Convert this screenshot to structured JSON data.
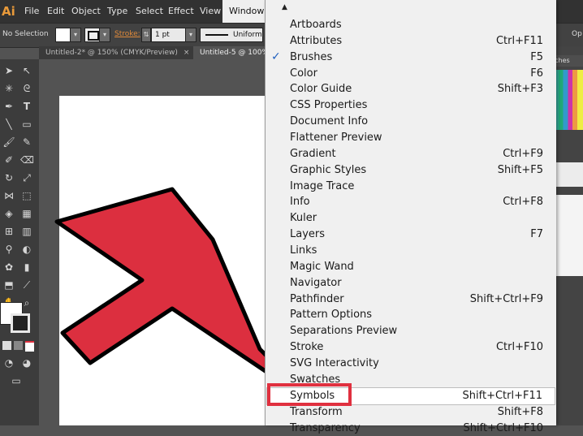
{
  "app": {
    "logo": "Ai"
  },
  "menubar": {
    "items": [
      "File",
      "Edit",
      "Object",
      "Type",
      "Select",
      "Effect",
      "View",
      "Window"
    ]
  },
  "controlbar": {
    "selection": "No Selection",
    "stroke_label": "Stroke:",
    "stroke_weight": "1 pt",
    "profile": "Uniform",
    "opacity_partial": "Op"
  },
  "tabs": [
    {
      "label": "Untitled-2* @ 150% (CMYK/Preview)",
      "close": "×"
    },
    {
      "label": "Untitled-5 @ 100%",
      "close": ""
    }
  ],
  "right_panel": {
    "tab_label": "tches"
  },
  "window_menu": {
    "scroll_up_glyph": "▲",
    "checkmark": "✓",
    "items": [
      {
        "label": "Artboards",
        "shortcut": ""
      },
      {
        "label": "Attributes",
        "shortcut": "Ctrl+F11"
      },
      {
        "label": "Brushes",
        "shortcut": "F5",
        "checked": true
      },
      {
        "label": "Color",
        "shortcut": "F6"
      },
      {
        "label": "Color Guide",
        "shortcut": "Shift+F3"
      },
      {
        "label": "CSS Properties",
        "shortcut": ""
      },
      {
        "label": "Document Info",
        "shortcut": ""
      },
      {
        "label": "Flattener Preview",
        "shortcut": ""
      },
      {
        "label": "Gradient",
        "shortcut": "Ctrl+F9"
      },
      {
        "label": "Graphic Styles",
        "shortcut": "Shift+F5"
      },
      {
        "label": "Image Trace",
        "shortcut": ""
      },
      {
        "label": "Info",
        "shortcut": "Ctrl+F8"
      },
      {
        "label": "Kuler",
        "shortcut": ""
      },
      {
        "label": "Layers",
        "shortcut": "F7"
      },
      {
        "label": "Links",
        "shortcut": ""
      },
      {
        "label": "Magic Wand",
        "shortcut": ""
      },
      {
        "label": "Navigator",
        "shortcut": ""
      },
      {
        "label": "Pathfinder",
        "shortcut": "Shift+Ctrl+F9"
      },
      {
        "label": "Pattern Options",
        "shortcut": ""
      },
      {
        "label": "Separations Preview",
        "shortcut": ""
      },
      {
        "label": "Stroke",
        "shortcut": "Ctrl+F10"
      },
      {
        "label": "SVG Interactivity",
        "shortcut": ""
      },
      {
        "label": "Swatches",
        "shortcut": ""
      },
      {
        "label": "Symbols",
        "shortcut": "Shift+Ctrl+F11",
        "highlighted": true
      },
      {
        "label": "Transform",
        "shortcut": "Shift+F8"
      },
      {
        "label": "Transparency",
        "shortcut": "Shift+Ctrl+F10"
      }
    ]
  },
  "colors": {
    "arrow_fill": "#dc2f3f",
    "highlight_box": "#e0303f",
    "menubar_bg": "#323232",
    "logo": "#e99a3a"
  }
}
